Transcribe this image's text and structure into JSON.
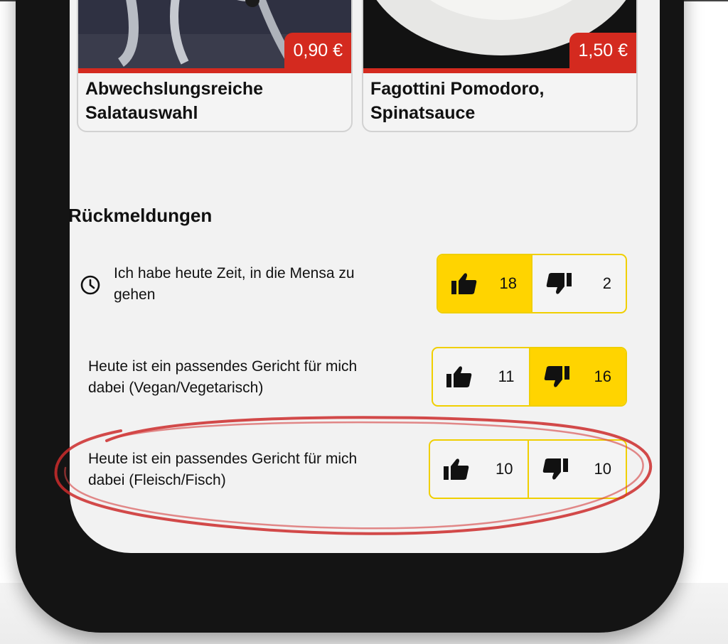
{
  "dishes": [
    {
      "title_line1": "Abwechslungsreiche",
      "title_line2": "Salatauswahl",
      "price": "0,90 €"
    },
    {
      "title_line1": "Fagottini Pomodoro,",
      "title_line2": "Spinatsauce",
      "price": "1,50 €"
    }
  ],
  "feedback": {
    "heading": "Rückmeldungen",
    "items": [
      {
        "line1": "Ich habe heute Zeit, in die Mensa zu",
        "line2": "gehen",
        "icon": "clock-icon",
        "up": "18",
        "down": "2",
        "selected": "up"
      },
      {
        "line1": "Heute ist ein passendes Gericht für mich",
        "line2": "dabei (Vegan/Vegetarisch)",
        "up": "11",
        "down": "16",
        "selected": "down"
      },
      {
        "line1": "Heute ist ein passendes Gericht für mich",
        "line2": "dabei (Fleisch/Fisch)",
        "up": "10",
        "down": "10",
        "selected": "none"
      }
    ]
  },
  "colors": {
    "accent": "#ffd400",
    "price_badge": "#d42a1f",
    "annotation": "#cc2b2b"
  }
}
